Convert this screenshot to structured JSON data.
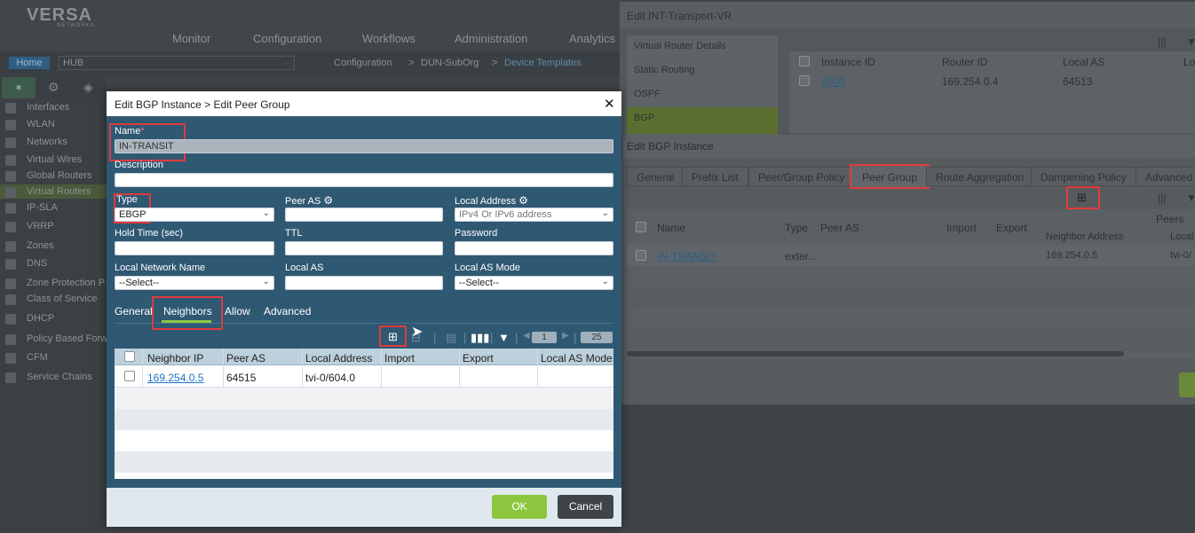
{
  "bg": {
    "logo": "VERSA",
    "logo_sub": "NETWORKS",
    "nav": [
      "Monitor",
      "Configuration",
      "Workflows",
      "Administration",
      "Analytics"
    ],
    "home": "Home",
    "hub": "HUB",
    "breadcrumb": [
      "Configuration",
      ">",
      "DUN-SubOrg",
      ">",
      "Device Templates"
    ],
    "sidebar": [
      "Interfaces",
      "WLAN",
      "Networks",
      "Virtual Wires",
      "Global Routers",
      "Virtual Routers",
      "IP-SLA",
      "VRRP",
      "Zones",
      "DNS",
      "Zone Protection P",
      "Class of Service",
      "DHCP",
      "Policy Based Forw",
      "CFM",
      "Service Chains"
    ]
  },
  "vr": {
    "title": "Edit INT-Transport-VR",
    "tabs": [
      "Virtual Router Details",
      "Static Routing",
      "OSPF",
      "BGP"
    ],
    "headers": [
      "Instance ID",
      "Router ID",
      "Local AS",
      "Lo"
    ],
    "row": [
      "3000",
      "169.254.0.4",
      "64513"
    ]
  },
  "bgp": {
    "title": "Edit BGP Instance",
    "tabs": [
      "General",
      "Prefix List",
      "Peer/Group Policy",
      "Peer Group",
      "Route Aggregation",
      "Dampening Policy",
      "Advanced"
    ],
    "headers": [
      "Name",
      "Type",
      "Peer AS",
      "Import",
      "Export",
      "Peers",
      "Neighbor Address",
      "Local"
    ],
    "row": [
      "IN-TRANSIT",
      "exter...",
      "169.254.0.5",
      "tvi-0/"
    ]
  },
  "dialog": {
    "title": "Edit BGP Instance > Edit Peer Group",
    "close": "✕",
    "name_label": "Name",
    "name_req": "*",
    "name_value": "IN-TRANSIT",
    "description_label": "Description",
    "type_label": "Type",
    "type_value": "EBGP",
    "peer_as_label": "Peer AS",
    "local_address_label": "Local Address",
    "local_address_placeholder": "IPv4 Or IPv6 address",
    "hold_time_label": "Hold Time (sec)",
    "ttl_label": "TTL",
    "password_label": "Password",
    "local_network_label": "Local Network Name",
    "local_network_value": "--Select--",
    "local_as_label": "Local AS",
    "local_as_mode_label": "Local AS Mode",
    "local_as_mode_value": "--Select--",
    "subtabs": [
      "General",
      "Neighbors",
      "Allow",
      "Advanced"
    ],
    "page": "1",
    "page_size": "25",
    "columns": [
      "Neighbor IP",
      "Peer AS",
      "Local Address",
      "Import",
      "Export",
      "Local AS Mode"
    ],
    "row": {
      "neighbor_ip": "169.254.0.5",
      "peer_as": "64515",
      "local_address": "tvi-0/604.0"
    },
    "ok": "OK",
    "cancel": "Cancel"
  },
  "colors": {
    "accent_red": "#e03a3f",
    "ok_green": "#8cc63f",
    "dialog_blue": "#2f5873",
    "link": "#1a74c4"
  }
}
